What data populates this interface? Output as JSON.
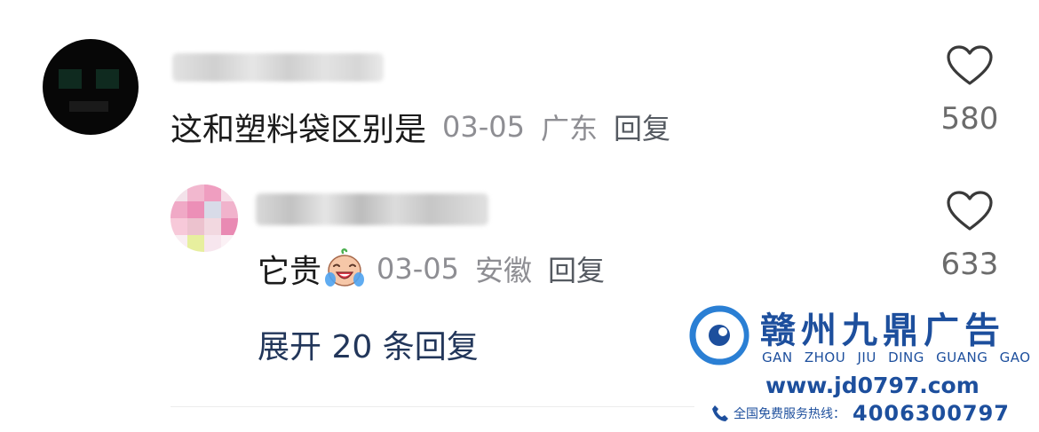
{
  "comment": {
    "text": "这和塑料袋区别是",
    "date": "03-05",
    "location": "广东",
    "reply_label": "回复",
    "likes": "580",
    "avatar_icon": "blurred-avatar",
    "username_blurred": true
  },
  "reply": {
    "text": "它贵",
    "emoji": "crying-laughing-emoji",
    "date": "03-05",
    "location": "安徽",
    "reply_label": "回复",
    "likes": "633",
    "avatar_icon": "blurred-avatar",
    "username_blurred": true
  },
  "expand_label": "展开 20 条回复",
  "watermark": {
    "title": "赣州九鼎广告",
    "pinyin": "GAN ZHOU JIU DING GUANG GAO",
    "url": "www.jd0797.com",
    "hotline_label": "全国免费服务热线：",
    "hotline_number": "4006300797"
  },
  "colors": {
    "text_primary": "#1b1b1b",
    "text_meta": "#8e8e93",
    "link_blue": "#22365a",
    "watermark_blue": "#1d4f9d"
  }
}
